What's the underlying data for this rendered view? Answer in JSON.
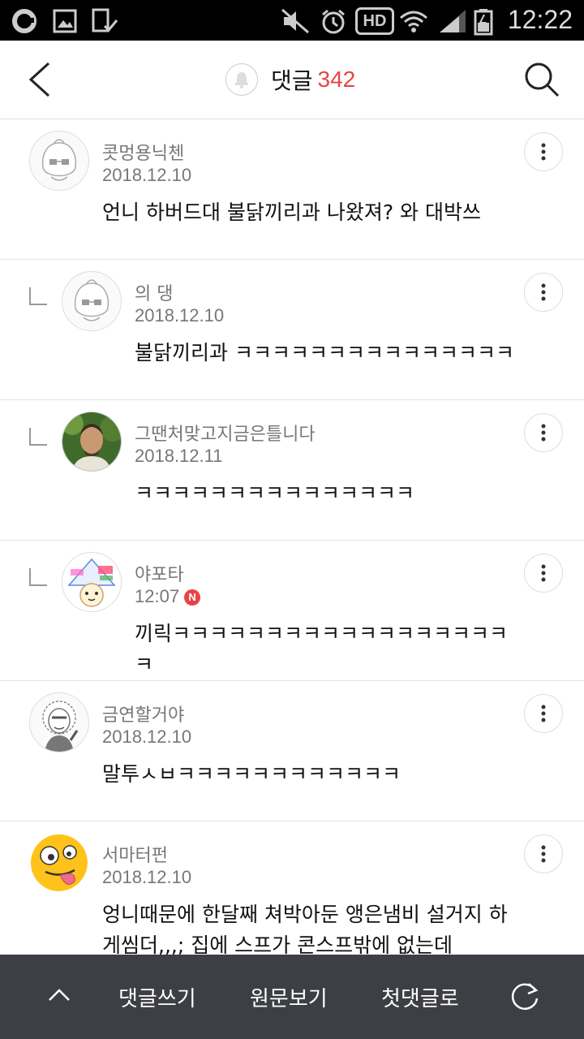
{
  "status_bar": {
    "time": "12:22",
    "icons": [
      "notification-o-icon",
      "image-icon",
      "tablet-check-icon",
      "mute-icon",
      "alarm-icon",
      "hd-icon",
      "wifi-icon",
      "signal-icon",
      "battery-icon"
    ],
    "hd_label": "HD"
  },
  "header": {
    "title": "댓글",
    "count": "342"
  },
  "comments": [
    {
      "author": "콧멍용닉첸",
      "date": "2018.12.10",
      "text": "언니 하버드대 불닭끼리과 나왔져? 와 대박쓰",
      "reply": false,
      "new": false
    },
    {
      "author": "의 댕",
      "date": "2018.12.10",
      "text": "불닭끼리과 ㅋㅋㅋㅋㅋㅋㅋㅋㅋㅋㅋㅋㅋㅋㅋ",
      "reply": true,
      "new": false
    },
    {
      "author": "그땐처맞고지금은틀니다",
      "date": "2018.12.11",
      "text": "ㅋㅋㅋㅋㅋㅋㅋㅋㅋㅋㅋㅋㅋㅋㅋ",
      "reply": true,
      "new": false
    },
    {
      "author": "야포타",
      "date": "12:07",
      "text": "끼릭ㅋㅋㅋㅋㅋㅋㅋㅋㅋㅋㅋㅋㅋㅋㅋㅋㅋㅋㅋ",
      "reply": true,
      "new": true,
      "badge": "N"
    },
    {
      "author": "금연할거야",
      "date": "2018.12.10",
      "text": "말투ㅅㅂㅋㅋㅋㅋㅋㅋㅋㅋㅋㅋㅋㅋ",
      "reply": false,
      "new": false
    },
    {
      "author": "서마터펀",
      "date": "2018.12.10",
      "text": "엉니때문에 한달째 쳐박아둔 앵은냄비 설거지 하게씸더,,,; 집에 스프가 콘스프밖에 없는데",
      "reply": false,
      "new": false
    }
  ],
  "bottom_bar": {
    "write": "댓글쓰기",
    "original": "원문보기",
    "first": "첫댓글로"
  }
}
